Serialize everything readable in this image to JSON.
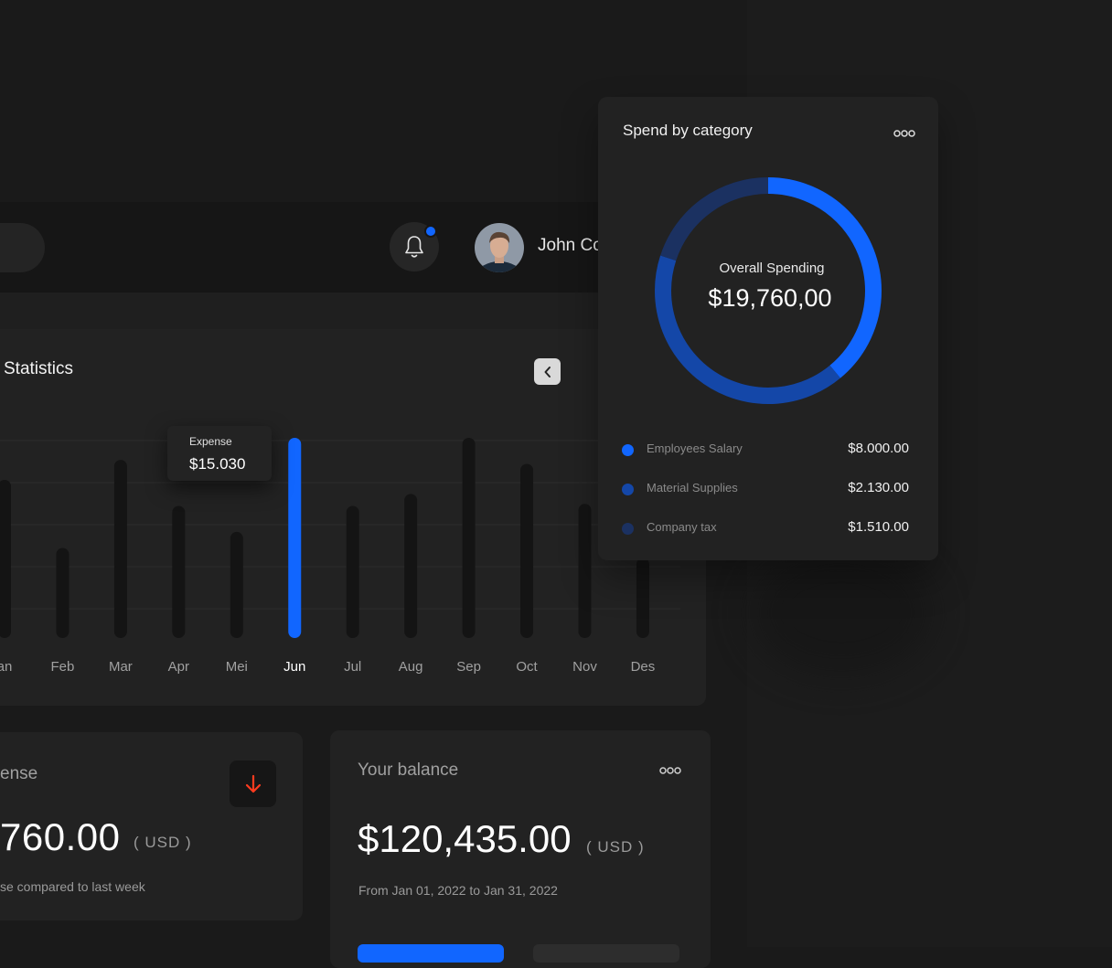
{
  "header": {
    "user_name": "John Co",
    "has_notification": true
  },
  "statistics": {
    "title": "Statistics",
    "tooltip": {
      "label": "Expense",
      "value": "$15.030"
    }
  },
  "chart_data": {
    "type": "bar",
    "categories": [
      "an",
      "Feb",
      "Mar",
      "Apr",
      "Mei",
      "Jun",
      "Jul",
      "Aug",
      "Sep",
      "Oct",
      "Nov",
      "Des"
    ],
    "values": [
      79,
      45,
      89,
      66,
      53,
      100,
      66,
      72,
      100,
      87,
      67,
      40
    ],
    "highlight_index": 5,
    "ylim": [
      0,
      100
    ],
    "grid": true,
    "colors": {
      "bar": "#141414",
      "highlight": "#1166ff",
      "grid": "#2c2c2c"
    }
  },
  "expense_card": {
    "title": "ense",
    "amount": "760.00",
    "currency": "( USD )",
    "note": "se compared to last week",
    "trend": "down-arrow-icon",
    "trend_color": "#ff3b1f"
  },
  "balance_card": {
    "title": "Your balance",
    "amount": "$120,435.00",
    "currency": "( USD )",
    "range": "From Jan 01, 2022 to Jan 31, 2022"
  },
  "spend_by_category": {
    "title": "Spend by category",
    "center_label": "Overall Spending",
    "center_value": "$19,760,00",
    "items": [
      {
        "name": "Employees Salary",
        "value": "$8.000.00",
        "color": "#1166ff"
      },
      {
        "name": "Material Supplies",
        "value": "$2.130.00",
        "color": "#1447a8"
      },
      {
        "name": "Company tax",
        "value": "$1.510.00",
        "color": "#1b3161"
      }
    ],
    "donut_shares": [
      0.39,
      0.41,
      0.2
    ]
  },
  "colors": {
    "accent": "#1166ff",
    "background": "#1a1a1a",
    "card": "#222222"
  }
}
